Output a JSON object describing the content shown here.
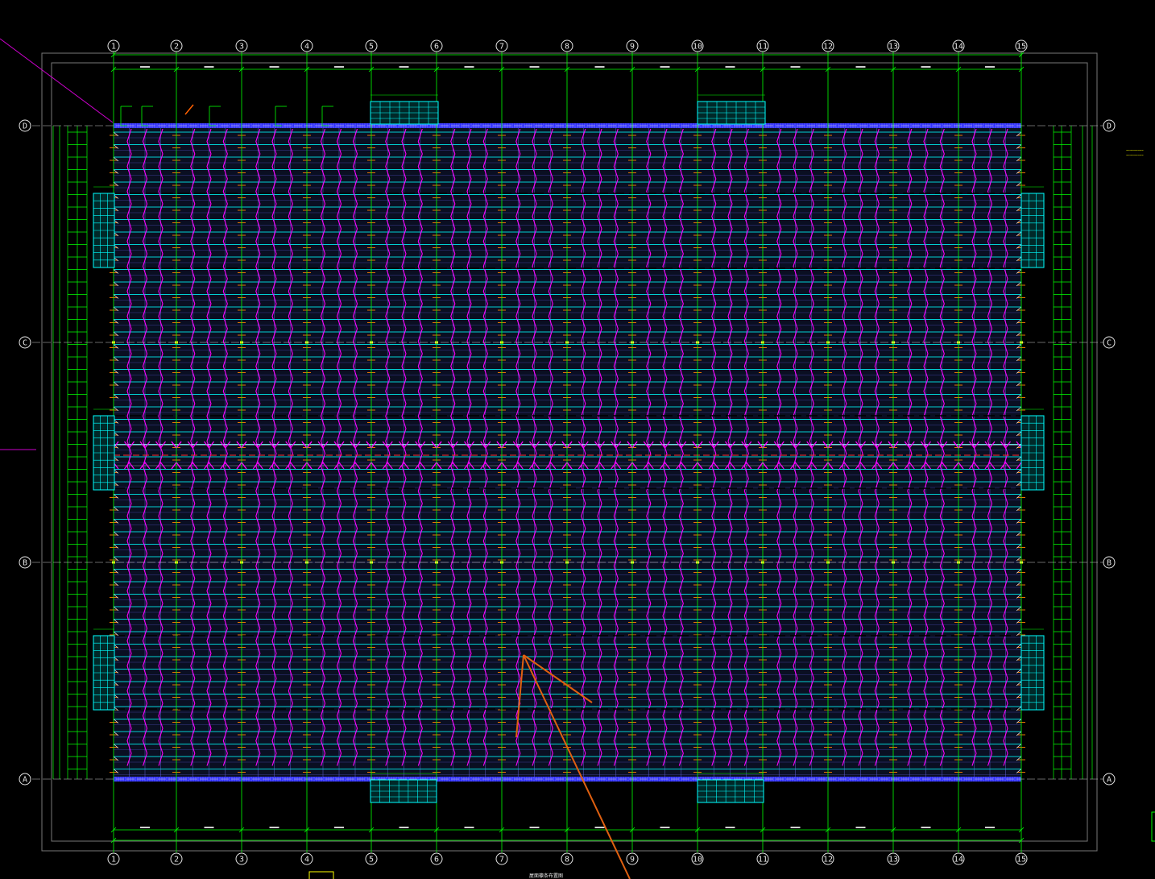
{
  "drawing": {
    "columns": [
      "1",
      "2",
      "3",
      "4",
      "5",
      "6",
      "7",
      "8",
      "9",
      "10",
      "11",
      "12",
      "13",
      "14",
      "15"
    ],
    "rows": [
      "D",
      "C",
      "B",
      "A"
    ],
    "title_below": "屋面檩条布置图",
    "colors": {
      "background": "#000000",
      "grid_line": "#00ff00",
      "purlin": "#00ffff",
      "rafter": "#ff00ff",
      "edge_beam": "#3030ff",
      "tie_bar": "#ff8000",
      "gutter_line": "#ff3030",
      "annotation_leader": "#e06010",
      "axis_bubble": "#e6e6e6"
    }
  }
}
